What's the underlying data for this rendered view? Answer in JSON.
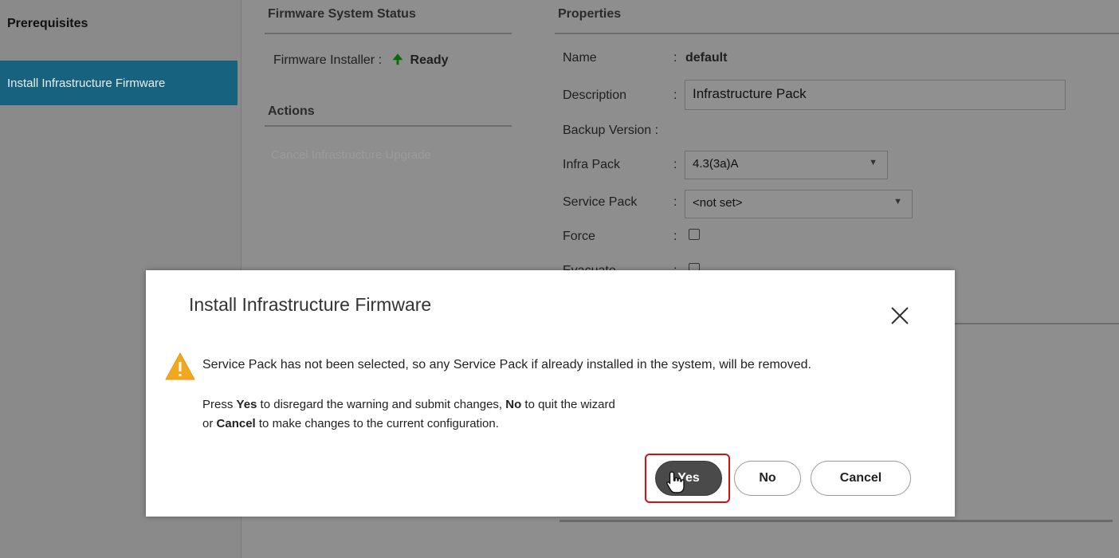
{
  "sidebar": {
    "heading": "Prerequisites",
    "active_item": "Install Infrastructure Firmware"
  },
  "firmware_status": {
    "title": "Firmware System Status",
    "installer_label": "Firmware Installer :",
    "installer_status": "Ready"
  },
  "actions": {
    "title": "Actions",
    "cancel_upgrade": "Cancel Infrastructure Upgrade"
  },
  "properties": {
    "title": "Properties",
    "name_label": "Name",
    "name_value": "default",
    "description_label": "Description",
    "description_value": "Infrastructure Pack",
    "backup_label": "Backup Version :",
    "infra_label": "Infra Pack",
    "infra_value": "4.3(3a)A",
    "service_label": "Service Pack",
    "service_value": "<not set>",
    "force_label": "Force",
    "evacuate_label": "Evacuate",
    "colon": ":"
  },
  "dialog": {
    "title": "Install Infrastructure Firmware",
    "warning": "Service Pack has not been selected, so any Service Pack if already installed in the system, will be removed.",
    "instr_press": "Press ",
    "instr_yes": "Yes",
    "instr_mid1": " to disregard the warning and submit changes, ",
    "instr_no": "No",
    "instr_mid2": " to quit the wizard",
    "instr_or": "or ",
    "instr_cancel": "Cancel",
    "instr_end": " to make changes to the current configuration.",
    "buttons": {
      "yes": "Yes",
      "no": "No",
      "cancel": "Cancel"
    }
  },
  "icons": {
    "warning": "warning-icon",
    "close": "close-icon",
    "status_arrow": "arrow-up-icon",
    "cursor": "hand-cursor-icon"
  },
  "colors": {
    "sidebar_active": "#17627f",
    "status_arrow": "#0b6b0b",
    "warning": "#f2a81d",
    "highlight": "#d0101a",
    "primary_button": "#4a4a4a"
  }
}
